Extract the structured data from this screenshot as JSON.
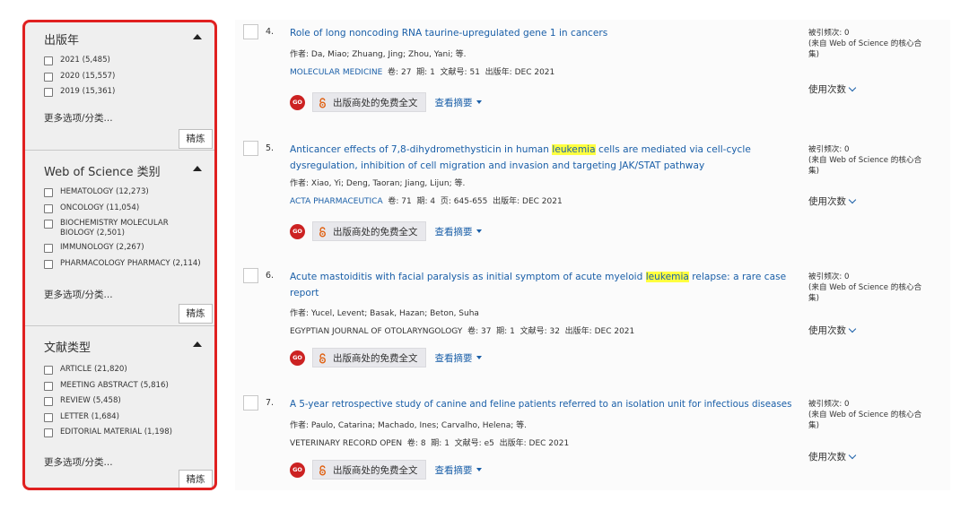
{
  "sidebar": {
    "sections": [
      {
        "title": "出版年",
        "options": [
          "2021 (5,485)",
          "2020 (15,557)",
          "2019 (15,361)"
        ],
        "more": "更多选项/分类...",
        "refine": "精炼"
      },
      {
        "title": "Web of Science 类别",
        "options": [
          "HEMATOLOGY (12,273)",
          "ONCOLOGY (11,054)",
          "BIOCHEMISTRY MOLECULAR BIOLOGY (2,501)",
          "IMMUNOLOGY (2,267)",
          "PHARMACOLOGY PHARMACY (2,114)"
        ],
        "more": "更多选项/分类...",
        "refine": "精炼"
      },
      {
        "title": "文献类型",
        "options": [
          "ARTICLE (21,820)",
          "MEETING ABSTRACT (5,816)",
          "REVIEW (5,458)",
          "LETTER (1,684)",
          "EDITORIAL MATERIAL (1,198)"
        ],
        "more": "更多选项/分类...",
        "refine": "精炼"
      }
    ]
  },
  "labels": {
    "authors": "作者:",
    "volume": "卷:",
    "issue": "期:",
    "article_no": "文献号:",
    "pages": "页:",
    "pub_year": "出版年:",
    "go": "GO",
    "full_text": "出版商处的免费全文",
    "view_abstract": "查看摘要",
    "cited_count": "被引频次: 0",
    "cited_source": "(来自 Web of Science 的核心合集)",
    "usage": "使用次数"
  },
  "records": [
    {
      "num": "4.",
      "title_before": "Role of long noncoding RNA taurine-upregulated gene 1 in cancers",
      "title_highlight": "",
      "title_after": "",
      "authors": "Da, Miao; Zhuang, Jing; Zhou, Yani; 等.",
      "source": "MOLECULAR MEDICINE",
      "volume": "27",
      "issue": "1",
      "loc_label": "文献号:",
      "loc": "51",
      "date": "DEC 2021"
    },
    {
      "num": "5.",
      "title_before": "Anticancer effects of 7,8-dihydromethysticin in human ",
      "title_highlight": "leukemia",
      "title_after": " cells are mediated via cell-cycle dysregulation, inhibition of cell migration and invasion and targeting JAK/STAT pathway",
      "authors": "Xiao, Yi; Deng, Taoran; Jiang, Lijun; 等.",
      "source": "ACTA PHARMACEUTICA",
      "volume": "71",
      "issue": "4",
      "loc_label": "页:",
      "loc": "645-655",
      "date": "DEC 2021"
    },
    {
      "num": "6.",
      "title_before": "Acute mastoiditis with facial paralysis as initial symptom of acute myeloid ",
      "title_highlight": "leukemia",
      "title_after": " relapse: a rare case report",
      "authors": "Yucel, Levent; Basak, Hazan; Beton, Suha",
      "source": "EGYPTIAN JOURNAL OF OTOLARYNGOLOGY",
      "volume": "37",
      "issue": "1",
      "loc_label": "文献号:",
      "loc": "32",
      "date": "DEC 2021"
    },
    {
      "num": "7.",
      "title_before": "A 5-year retrospective study of canine and feline patients referred to an isolation unit for infectious diseases",
      "title_highlight": "",
      "title_after": "",
      "authors": "Paulo, Catarina; Machado, Ines; Carvalho, Helena; 等.",
      "source": "VETERINARY RECORD OPEN",
      "volume": "8",
      "issue": "1",
      "loc_label": "文献号:",
      "loc": "e5",
      "date": "DEC 2021"
    }
  ]
}
